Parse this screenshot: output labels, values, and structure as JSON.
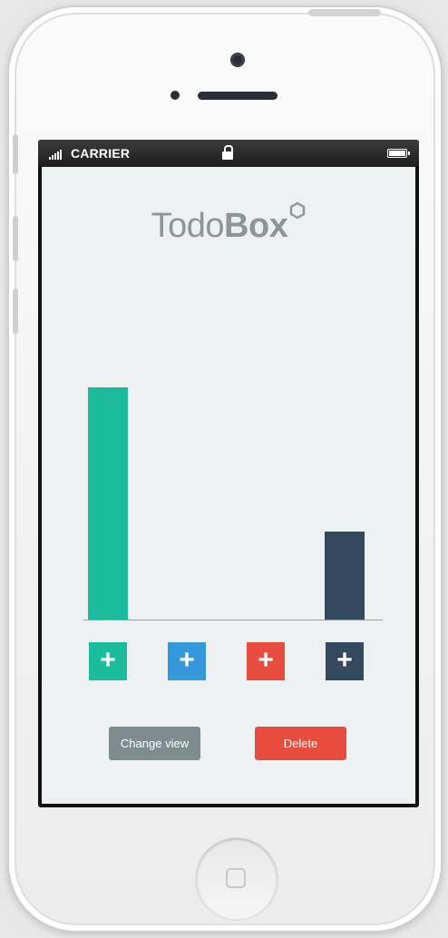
{
  "statusbar": {
    "carrier": "CARRIER"
  },
  "app": {
    "logo": {
      "part1": "Todo",
      "part2": "Box"
    },
    "actions": {
      "change_view_label": "Change view",
      "delete_label": "Delete"
    }
  },
  "add_buttons": [
    {
      "label": "+",
      "color": "#1abc9c"
    },
    {
      "label": "+",
      "color": "#3498db"
    },
    {
      "label": "+",
      "color": "#e74c3c"
    },
    {
      "label": "+",
      "color": "#34495e"
    }
  ],
  "chart_data": {
    "type": "bar",
    "categories": [
      "",
      "",
      "",
      ""
    ],
    "values": [
      100,
      0,
      0,
      38
    ],
    "colors": [
      "#1abc9c",
      "#3498db",
      "#e74c3c",
      "#34495e"
    ],
    "ylim": [
      0,
      100
    ]
  },
  "colors": {
    "change_view": "#7f8c8d",
    "delete": "#e74c3c",
    "background": "#eef1f2"
  }
}
